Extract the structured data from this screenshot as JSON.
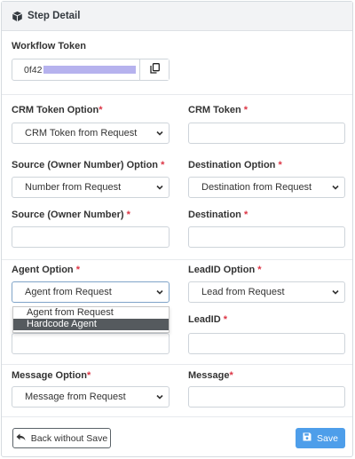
{
  "panel": {
    "title": "Step Detail",
    "title_icon": "cube-icon"
  },
  "workflow_token": {
    "label": "Workflow Token",
    "value_prefix": "0f42",
    "copy_icon": "copy-icon"
  },
  "crm_token_option": {
    "label": "CRM Token Option",
    "required_mark": "*",
    "selected": "CRM Token from Request"
  },
  "crm_token": {
    "label": "CRM Token ",
    "required_mark": "*",
    "value": ""
  },
  "source_option": {
    "label": "Source (Owner Number) Option ",
    "required_mark": "*",
    "selected": "Number from Request"
  },
  "destination_option": {
    "label": "Destination Option ",
    "required_mark": "*",
    "selected": "Destination from Request"
  },
  "source": {
    "label": "Source (Owner Number) ",
    "required_mark": "*",
    "value": ""
  },
  "destination": {
    "label": "Destination ",
    "required_mark": "*",
    "value": ""
  },
  "agent_option": {
    "label": "Agent Option ",
    "required_mark": "*",
    "selected": "Agent from Request",
    "options": [
      "Agent from Request",
      "Hardcode Agent"
    ],
    "highlighted": "Hardcode Agent"
  },
  "leadid_option": {
    "label": "LeadID Option ",
    "required_mark": "*",
    "selected": "Lead from Request"
  },
  "leadid": {
    "label": "LeadID ",
    "required_mark": "*",
    "value": ""
  },
  "message_option": {
    "label": "Message Option",
    "required_mark": "*",
    "selected": "Message from Request"
  },
  "message": {
    "label": "Message",
    "required_mark": "*",
    "value": ""
  },
  "footer": {
    "back_label": "Back without Save",
    "save_label": "Save"
  },
  "colors": {
    "primary": "#4e9eea",
    "required": "#dc3545",
    "header_bg": "#f2f3f5",
    "highlight": "#555a5e"
  }
}
